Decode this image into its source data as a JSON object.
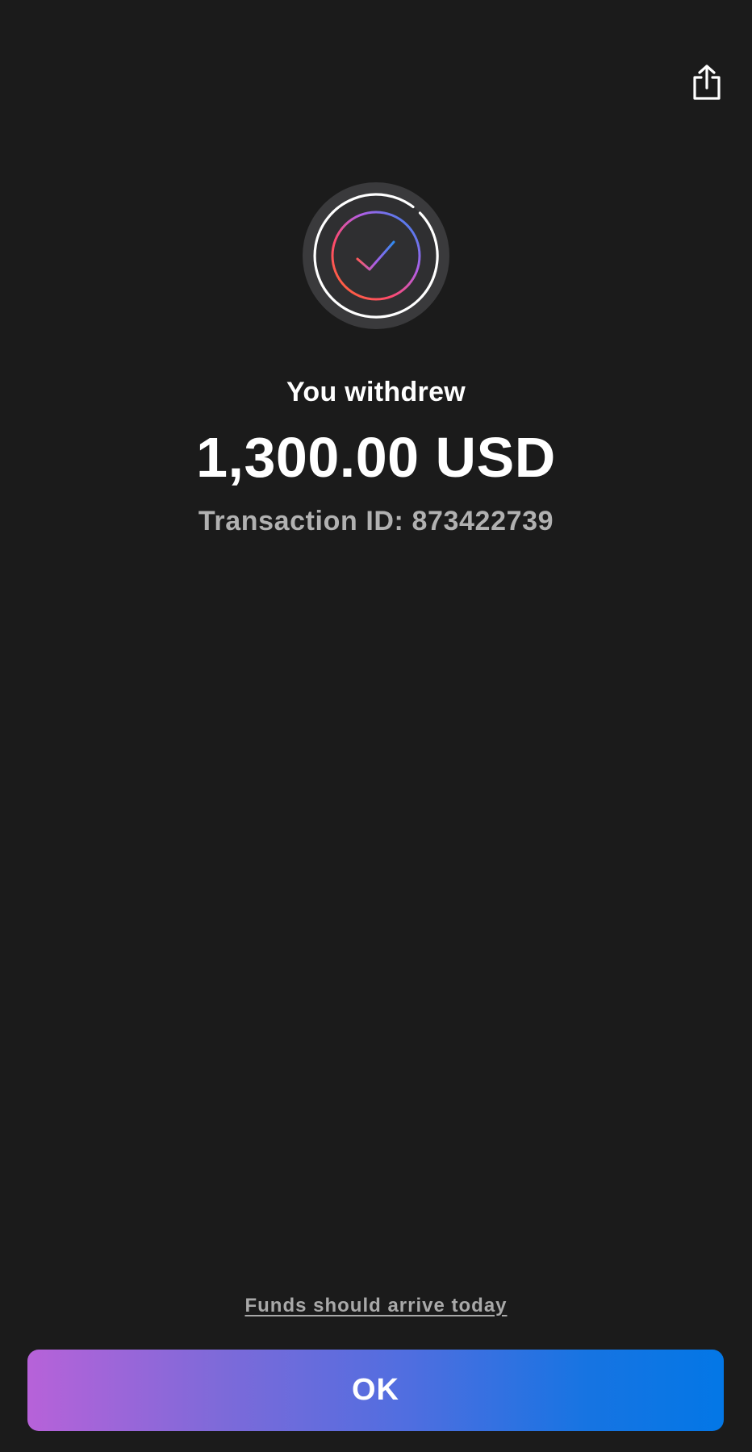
{
  "header": {
    "share_icon": "share-icon"
  },
  "status": {
    "icon": "success-check-icon",
    "title": "You withdrew",
    "amount": "1,300.00 USD",
    "transaction_id": "Transaction ID: 873422739"
  },
  "footer": {
    "arrival_link": "Funds should arrive today",
    "ok_label": "OK"
  },
  "colors": {
    "background": "#1b1b1b",
    "badge_outer": "#3a3a3c",
    "badge_inner": "#2f2f31",
    "secondary_text": "#b1b1b1",
    "button_gradient_start": "#b762d9",
    "button_gradient_end": "#0377e6"
  }
}
